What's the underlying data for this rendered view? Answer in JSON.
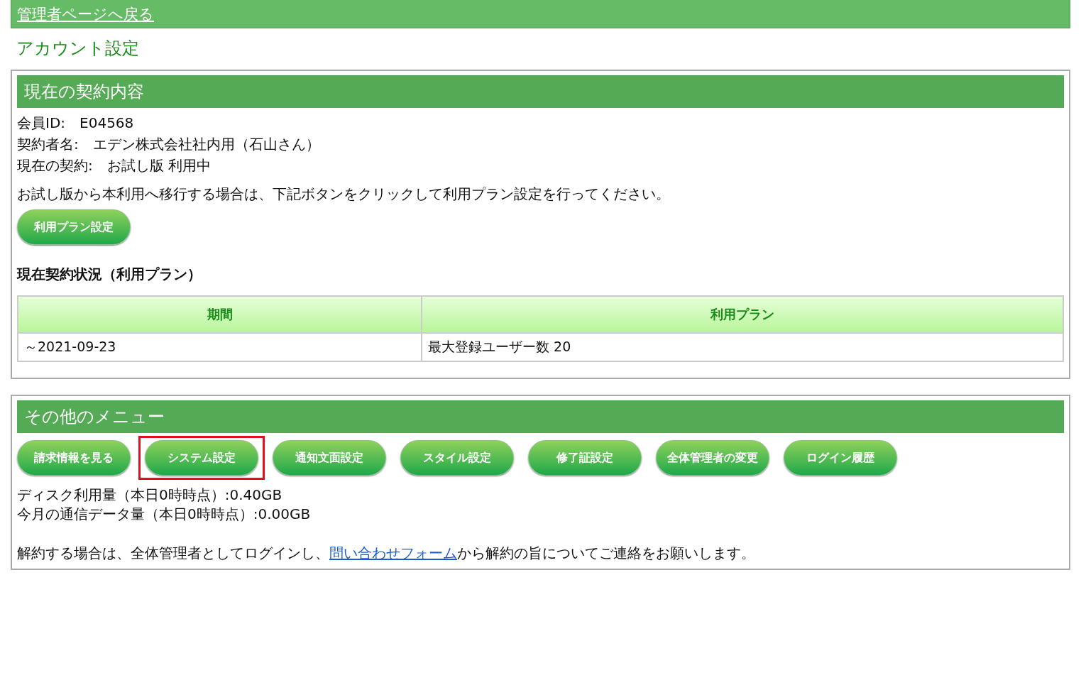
{
  "top_link": "管理者ページへ戻る",
  "page_title": "アカウント設定",
  "contract": {
    "heading": "現在の契約内容",
    "fields": [
      {
        "label": "会員ID:",
        "value": "E04568"
      },
      {
        "label": "契約者名:",
        "value": "エデン株式会社社内用（石山さん）"
      },
      {
        "label": "現在の契約:",
        "value": "お試し版 利用中"
      }
    ],
    "notice": "お試し版から本利用へ移行する場合は、下記ボタンをクリックして利用プラン設定を行ってください。",
    "plan_button": "利用プラン設定",
    "status_heading": "現在契約状況（利用プラン）",
    "table": {
      "columns": [
        "期間",
        "利用プラン"
      ],
      "rows": [
        [
          "～2021-09-23",
          "最大登録ユーザー数 20"
        ]
      ]
    }
  },
  "other_menu": {
    "heading": "その他のメニュー",
    "buttons": [
      {
        "label": "請求情報を見る",
        "highlighted": false
      },
      {
        "label": "システム設定",
        "highlighted": true
      },
      {
        "label": "通知文面設定",
        "highlighted": false
      },
      {
        "label": "スタイル設定",
        "highlighted": false
      },
      {
        "label": "修了証設定",
        "highlighted": false
      },
      {
        "label": "全体管理者の変更",
        "highlighted": false
      },
      {
        "label": "ログイン履歴",
        "highlighted": false
      }
    ],
    "usage": [
      "ディスク利用量（本日0時時点）:0.40GB",
      "今月の通信データ量（本日0時時点）:0.00GB"
    ],
    "cancel_before": "解約する場合は、全体管理者としてログインし、",
    "cancel_link": "問い合わせフォーム",
    "cancel_after": "から解約の旨についてご連絡をお願いします。"
  }
}
